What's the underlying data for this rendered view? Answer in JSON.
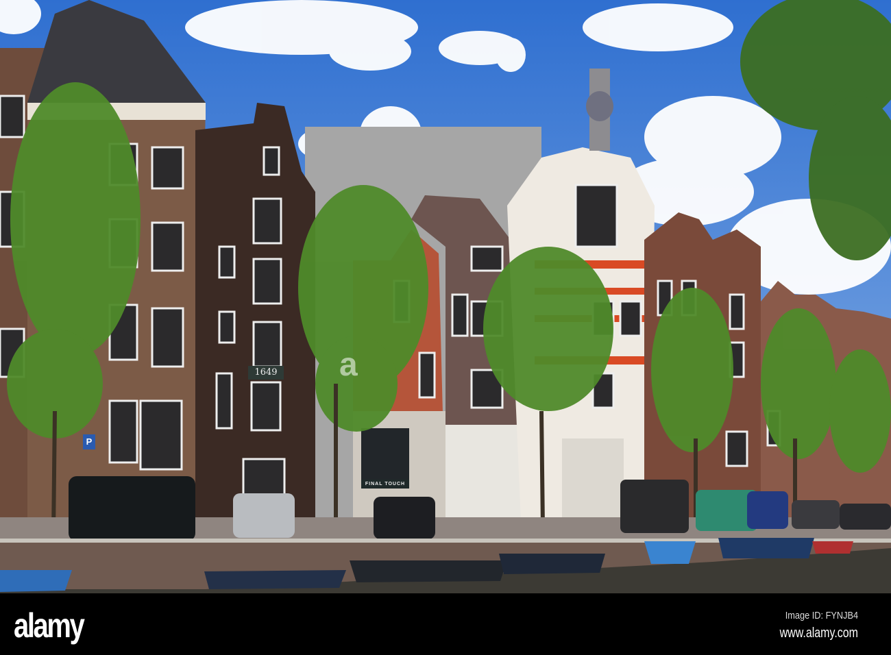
{
  "photo": {
    "subject": "Amsterdam canal houses",
    "plaque_year": "1649",
    "shop_sign": "FINAL TOUCH",
    "parking_sign": "P"
  },
  "watermark": {
    "logo": "alamy",
    "mark": "a",
    "image_id": "Image ID: FYNJB4",
    "website": "www.alamy.com"
  },
  "colors": {
    "sky": "#3f7fd6",
    "water": "#3c3a34",
    "footer": "#000000"
  }
}
